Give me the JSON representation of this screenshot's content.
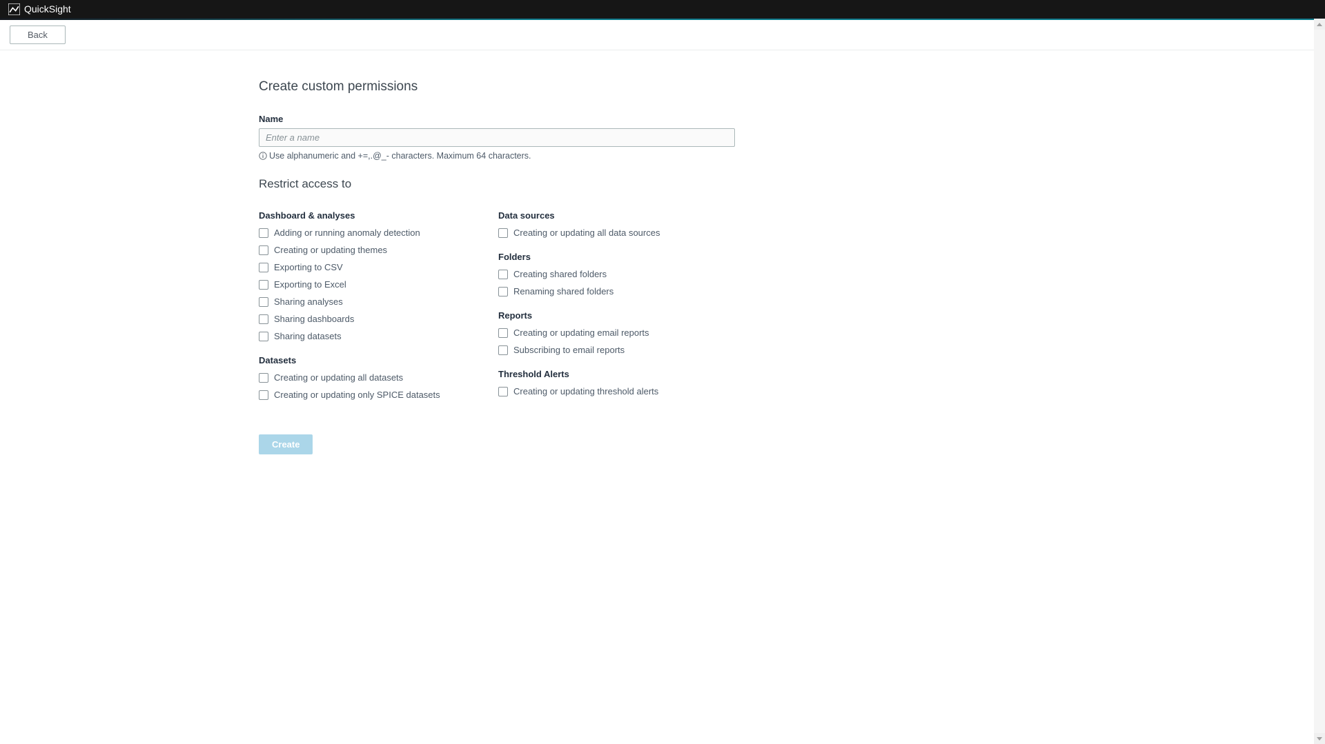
{
  "header": {
    "product": "QuickSight"
  },
  "toolbar": {
    "back": "Back"
  },
  "main": {
    "title": "Create custom permissions",
    "name_label": "Name",
    "name_placeholder": "Enter a name",
    "name_help": "Use alphanumeric and +=,.@_- characters. Maximum 64 characters.",
    "restrict_heading": "Restrict access to",
    "left": {
      "dashboard_analyses": {
        "title": "Dashboard & analyses",
        "items": [
          "Adding or running anomaly detection",
          "Creating or updating themes",
          "Exporting to CSV",
          "Exporting to Excel",
          "Sharing analyses",
          "Sharing dashboards",
          "Sharing datasets"
        ]
      },
      "datasets": {
        "title": "Datasets",
        "items": [
          "Creating or updating all datasets",
          "Creating or updating only SPICE datasets"
        ]
      }
    },
    "right": {
      "data_sources": {
        "title": "Data sources",
        "items": [
          "Creating or updating all data sources"
        ]
      },
      "folders": {
        "title": "Folders",
        "items": [
          "Creating shared folders",
          "Renaming shared folders"
        ]
      },
      "reports": {
        "title": "Reports",
        "items": [
          "Creating or updating email reports",
          "Subscribing to email reports"
        ]
      },
      "threshold_alerts": {
        "title": "Threshold Alerts",
        "items": [
          "Creating or updating threshold alerts"
        ]
      }
    },
    "create_label": "Create"
  }
}
